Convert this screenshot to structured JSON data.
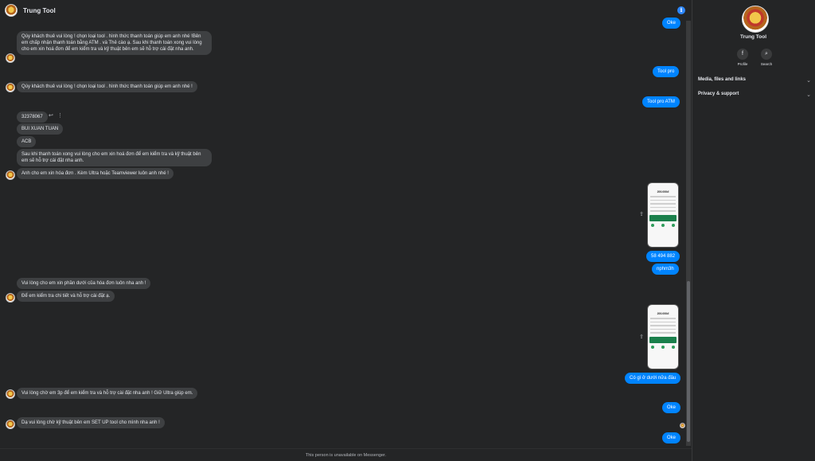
{
  "header": {
    "title": "Trung Tool"
  },
  "footer": {
    "text": "This person is unavailable on Messenger."
  },
  "sidebar": {
    "name": "Trung Tool",
    "profile_label": "Profile",
    "search_label": "Search",
    "sections": [
      "Media, files and links",
      "Privacy & support"
    ]
  },
  "messages": {
    "m_ok_top": "Oke",
    "m1": "Qúy khách thuê vui lòng ! chọn loại tool . hình thức thanh toán giúp em anh nhé !Bên em chấp nhận thanh toán bằng ATM . và Thẻ cào ạ. Sau khi thanh toán xong vui lòng cho em xin hoá đơn để em kiểm tra và kỹ thuật bên em sẽ hỗ trợ cài đặt nha anh.",
    "m_toolpro": "Tool pro",
    "m2": "Qúy khách thuê vui lòng ! chọn loại tool . hình thức thanh toán giúp em anh nhé !",
    "m_toolpro_atm": "Tool pro ATM",
    "m3": "32378067",
    "m4": "BUI XUAN TUAN",
    "m5": "ACB",
    "m6": "Sau khi thanh toán xong vui lòng cho em xin hoá đơn để em kiểm tra và kỹ thuật bên em sẽ hỗ trợ cài đặt nha anh.",
    "m7": "Anh cho  em xin hóa đơn . Kèm Ultra hoặc Teamviewer luôn anh nhé !",
    "img1_amount": "200.000đ",
    "m_code": "58 494 882",
    "m_name": "nphm3h",
    "m8": "Vui lòng cho em xin phần dưới của hóa đơn luôn nha anh !",
    "m9": "Để em kiểm tra chi tiết và hỗ trợ cài đặt ạ.",
    "img2_amount": "200.000đ",
    "m_bottom": "Có gì ở dưới nữa đâu",
    "m10": "Vui lòng chờ em 3p để em kiểm tra và hỗ trợ cài đặt nha anh ! Giữ Ultra giúp em.",
    "m_ok2": "Oke",
    "m11": "Dạ vui lòng chờ kỹ thuật bên em SET UP tool cho mình nha anh !",
    "m_ok3": "Oke"
  },
  "icons": {
    "info": "info-icon",
    "profile": "facebook-icon",
    "search": "search-icon",
    "share": "share-icon",
    "reply": "reply-icon",
    "more": "more-icon"
  },
  "colors": {
    "outgoing": "#0084ff",
    "incoming": "#3e4042",
    "background": "#242526"
  }
}
